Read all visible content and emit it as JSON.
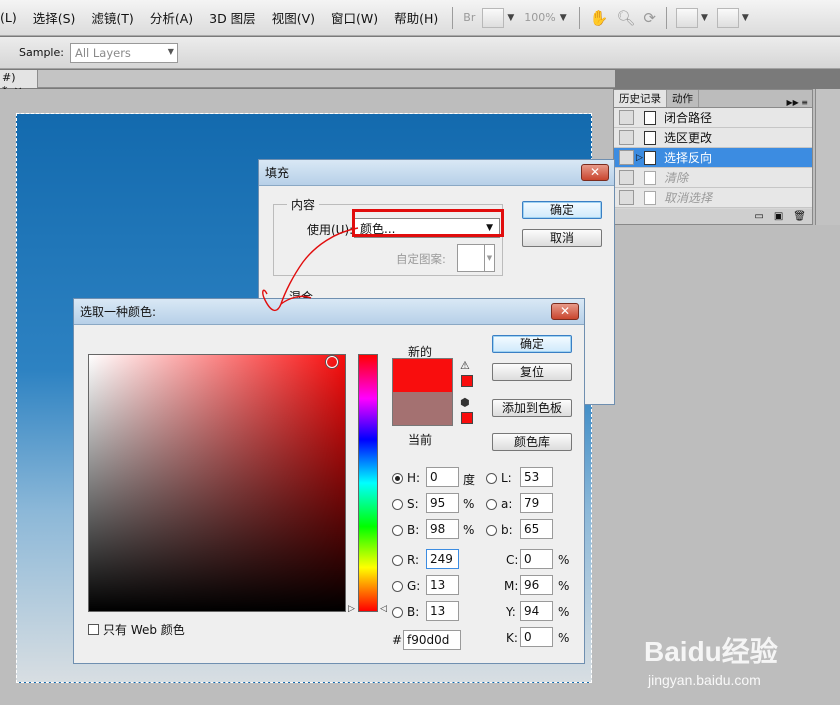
{
  "menu": {
    "items": [
      "(L)",
      "选择(S)",
      "滤镜(T)",
      "分析(A)",
      "3D 图层",
      "视图(V)",
      "窗口(W)",
      "帮助(H)"
    ],
    "toolbar_br": "Br",
    "zoom": "100%"
  },
  "options_bar": {
    "sample_label": "Sample:",
    "sample_value": "All Layers"
  },
  "doc_tab": {
    "label": "#) *",
    "close": "×"
  },
  "history_panel": {
    "tabs": [
      "历史记录",
      "动作"
    ],
    "items": [
      {
        "label": "闭合路径",
        "state": "normal"
      },
      {
        "label": "选区更改",
        "state": "normal"
      },
      {
        "label": "选择反向",
        "state": "selected"
      },
      {
        "label": "清除",
        "state": "undone"
      },
      {
        "label": "取消选择",
        "state": "undone"
      }
    ]
  },
  "fill_dialog": {
    "title": "填充",
    "content_group": "内容",
    "use_label": "使用(U):",
    "use_value": "颜色...",
    "pattern_label": "自定图案:",
    "blend_group": "混合",
    "ok": "确定",
    "cancel": "取消"
  },
  "color_picker": {
    "title": "选取一种颜色:",
    "new_label": "新的",
    "current_label": "当前",
    "new_color": "#f90d0d",
    "current_color": "#a47171",
    "ok": "确定",
    "reset": "复位",
    "add_to_swatches": "添加到色板",
    "color_libraries": "颜色库",
    "web_only": "只有 Web 颜色",
    "hsb": {
      "H": "0",
      "S": "95",
      "B": "98",
      "h_unit": "度",
      "s_unit": "%",
      "b_unit": "%"
    },
    "rgb": {
      "R": "249",
      "G": "13",
      "B": "13"
    },
    "lab": {
      "L": "53",
      "a": "79",
      "b": "65"
    },
    "cmyk": {
      "C": "0",
      "M": "96",
      "Y": "94",
      "K": "0",
      "unit": "%"
    },
    "hex_label": "#",
    "hex": "f90d0d"
  },
  "watermark": {
    "brand": "Baidu经验",
    "url": "jingyan.baidu.com"
  },
  "colors": {
    "annotation_red": "#e10d0d",
    "selection_blue": "#3c8ce1"
  }
}
